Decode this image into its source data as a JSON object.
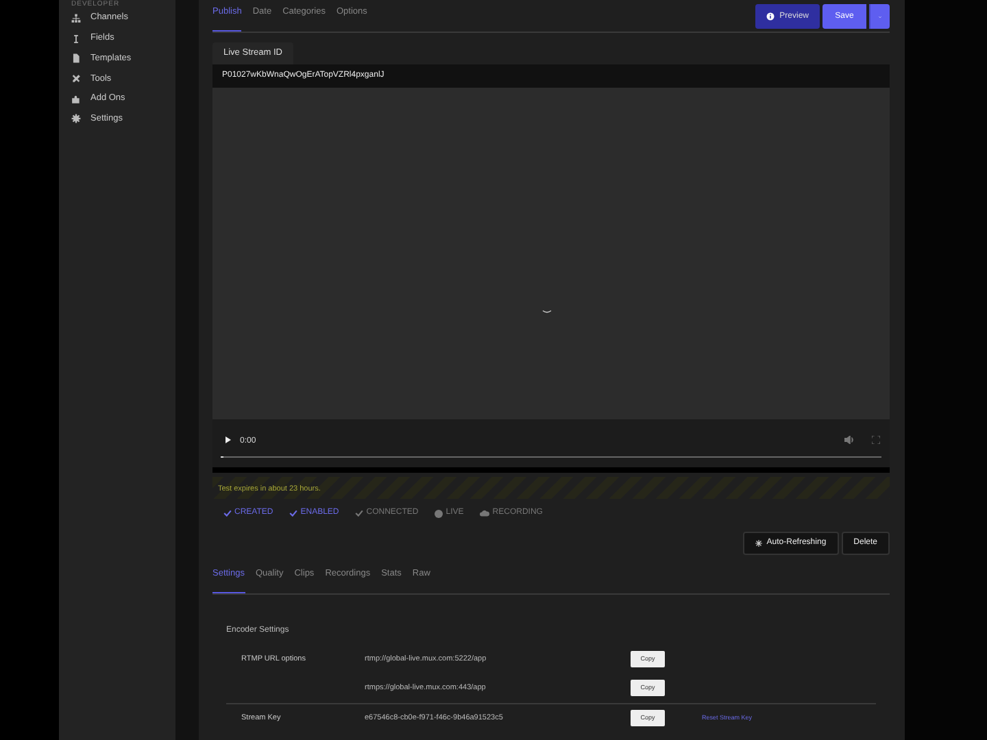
{
  "sidebar": {
    "heading": "DEVELOPER",
    "items": [
      {
        "label": "Channels"
      },
      {
        "label": "Fields"
      },
      {
        "label": "Templates"
      },
      {
        "label": "Tools"
      },
      {
        "label": "Add Ons"
      },
      {
        "label": "Settings"
      }
    ]
  },
  "tabs": [
    {
      "label": "Publish",
      "selected": true
    },
    {
      "label": "Date",
      "selected": false
    },
    {
      "label": "Categories",
      "selected": false
    },
    {
      "label": "Options",
      "selected": false
    }
  ],
  "header_buttons": {
    "preview": "Preview",
    "save": "Save"
  },
  "live_stream": {
    "label": "Live Stream ID",
    "value": "P01027wKbWnaQwOgErATopVZRl4pxganlJ"
  },
  "player": {
    "time": "0:00",
    "level": 0
  },
  "notice": "Test expires in about 23 hours.",
  "statuses": [
    {
      "label": "CREATED",
      "kind": "check",
      "active": true
    },
    {
      "label": "ENABLED",
      "kind": "check",
      "active": true
    },
    {
      "label": "CONNECTED",
      "kind": "check",
      "active": false
    },
    {
      "label": "LIVE",
      "kind": "dot",
      "active": false
    },
    {
      "label": "RECORDING",
      "kind": "cloud",
      "active": false
    }
  ],
  "actions": [
    "Auto-Refreshing",
    "Delete"
  ],
  "subtabs": [
    {
      "label": "Settings",
      "selected": true
    },
    {
      "label": "Quality",
      "selected": false
    },
    {
      "label": "Clips",
      "selected": false
    },
    {
      "label": "Recordings",
      "selected": false
    },
    {
      "label": "Stats",
      "selected": false
    },
    {
      "label": "Raw",
      "selected": false
    }
  ],
  "encoder": {
    "title": "Encoder Settings",
    "groups": [
      {
        "label": "RTMP URL options",
        "rows": [
          {
            "value": "rtmp://global-live.mux.com:5222/app",
            "button": "Copy"
          },
          {
            "value": "rtmps://global-live.mux.com:443/app",
            "button": "Copy"
          }
        ]
      },
      {
        "label": "Stream Key",
        "rows": [
          {
            "value": "e67546c8-cb0e-f971-f46c-9b46a91523c5",
            "button": "Copy",
            "link": "Reset Stream Key"
          }
        ]
      }
    ]
  }
}
